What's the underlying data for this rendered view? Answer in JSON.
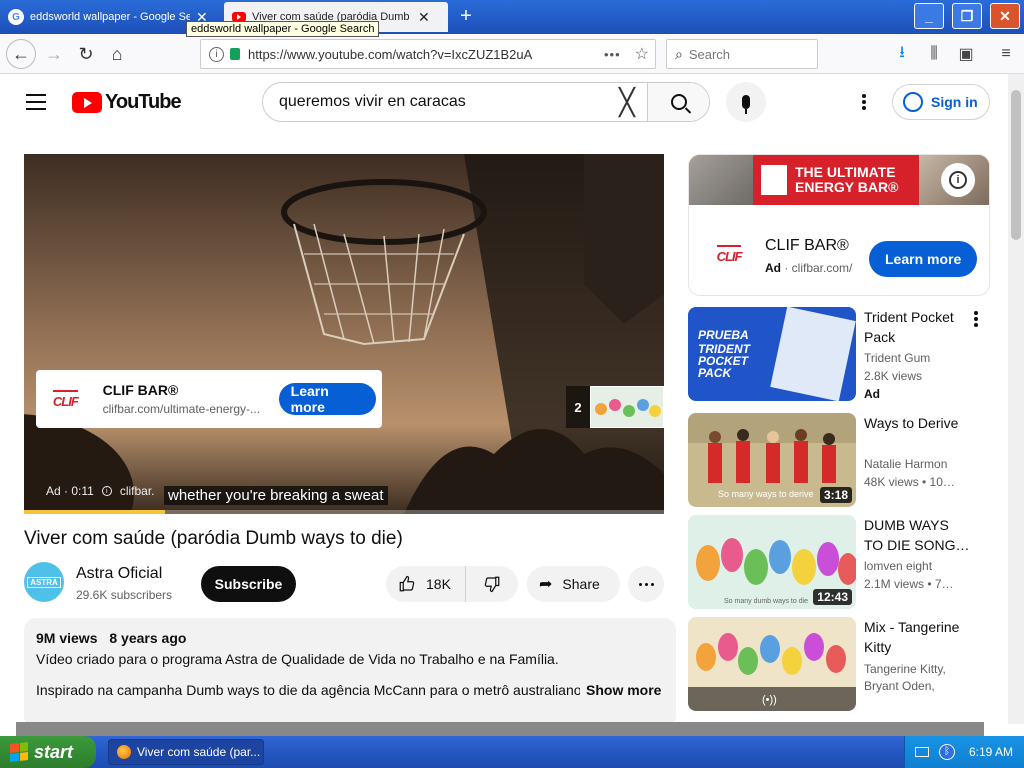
{
  "browser": {
    "tabs": [
      {
        "title": "eddsworld wallpaper - Google Search",
        "favicon": "google-icon"
      },
      {
        "title": "Viver com saúde (paródia Dumb w",
        "favicon": "youtube-icon",
        "active": true
      }
    ],
    "tooltip": "eddsworld wallpaper - Google Search",
    "url": "https://www.youtube.com/watch?v=IxcZUZ1B2uA",
    "search_placeholder": "Search"
  },
  "youtube": {
    "logo_text": "YouTube",
    "search_query": "queremos vivir en caracas",
    "signin_label": "Sign in"
  },
  "player": {
    "overlay_ad": {
      "brand": "CLIF BAR®",
      "domain": "clifbar.com/ultimate-energy-...",
      "button": "Learn more",
      "logo_text": "CLIF"
    },
    "queue_count": "2",
    "ad_label": "Ad · 0:11",
    "ad_domain": "clifbar.",
    "caption": "whether you're breaking a sweat",
    "ad_progress": 0.22
  },
  "video": {
    "title": "Viver com saúde (paródia Dumb ways to die)",
    "channel": {
      "name": "Astra Oficial",
      "subscribers": "29.6K subscribers",
      "avatar_text": "ASTRA"
    },
    "subscribe_label": "Subscribe",
    "likes": "18K",
    "share_label": "Share",
    "description": {
      "views": "9M views",
      "age": "8 years ago",
      "line1": "Vídeo criado para o programa Astra de Qualidade de Vida no Trabalho e na Família.",
      "line2": "Inspirado na campanha Dumb ways to die da agência McCann para o metrô australiano.",
      "show_more": "Show more"
    }
  },
  "sidebar": {
    "ad": {
      "banner_headline": "THE ULTIMATE ENERGY BAR®",
      "banner_logo": "CLIF",
      "name": "CLIF BAR®",
      "ad_tag": "Ad",
      "domain": "clifbar.com/",
      "button": "Learn more"
    },
    "recommendations": [
      {
        "title": "Trident Pocket Pack",
        "channel": "Trident Gum",
        "meta": "2.8K views",
        "ad": "Ad",
        "thumb_text": "PRUEBA TRIDENT POCKET PACK"
      },
      {
        "title": "Ways to Derive",
        "channel": "Natalie Harmon",
        "meta": "48K views  • 10…",
        "duration": "3:18",
        "thumb_caption": "So many ways to derive"
      },
      {
        "title": "DUMB WAYS TO DIE SONG…",
        "channel": "lomven eight",
        "meta": "2.1M views  • 7…",
        "duration": "12:43",
        "thumb_caption": "So many dumb ways to die"
      },
      {
        "title": "Mix - Tangerine Kitty",
        "channel": "Tangerine Kitty, Bryant Oden, PSY…",
        "meta": "",
        "mix_icon": "(•))"
      }
    ]
  },
  "taskbar": {
    "start_label": "start",
    "window_label": "Viver com saúde (par...",
    "clock": "6:19 AM"
  },
  "colors": {
    "youtube_red": "#ff0000",
    "link_blue": "#065fd4",
    "clif_red": "#d6202a",
    "xp_blue": "#2457c2",
    "ad_progress_yellow": "#f6c43a"
  }
}
